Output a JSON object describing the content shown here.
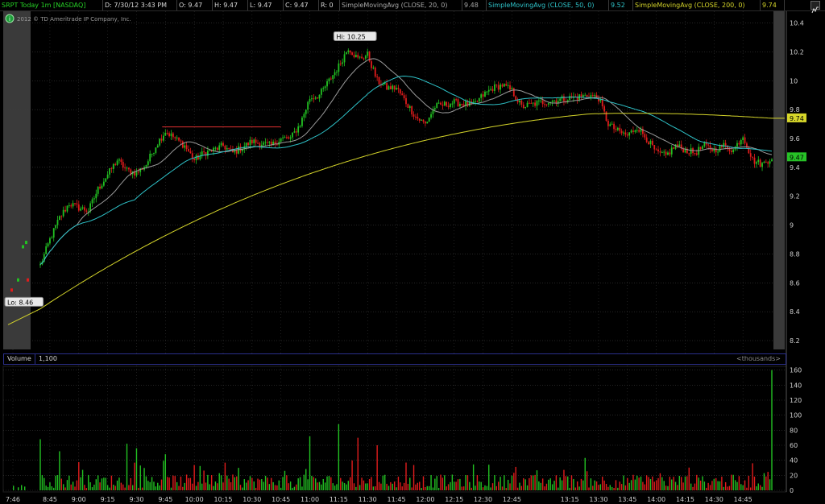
{
  "header": {
    "symbol": "SRPT Today 1m [NASDAQ]",
    "date": "D: 7/30/12 3:43 PM",
    "open": "O: 9.47",
    "high": "H: 9.47",
    "low": "L: 9.47",
    "close": "C: 9.47",
    "range": "R: 0",
    "sma20_label": "SimpleMovingAvg (CLOSE, 20, 0)",
    "sma20_value": "9.48",
    "sma50_label": "SimpleMovingAvg (CLOSE, 50, 0)",
    "sma50_value": "9.52",
    "sma200_label": "SimpleMovingAvg (CLOSE, 200, 0)",
    "sma200_value": "9.74",
    "settings_icon": "chart-settings-icon"
  },
  "copyright": "2012 © TD Ameritrade IP Company, Inc.",
  "info_icon": "info-icon",
  "colors": {
    "up": "#22c122",
    "down": "#e01c1c",
    "sma20": "#9a9a9a",
    "sma50": "#2ec2c8",
    "sma200": "#d6d62a",
    "grid": "#3c3c3c",
    "session_shade": "#3a3a3a",
    "hi_line": "#e03030"
  },
  "volume_header": {
    "label": "Volume",
    "value": "1,100",
    "units": "<thousands>"
  },
  "chart_data": [
    {
      "type": "candlestick",
      "title": "SRPT Today 1m [NASDAQ]",
      "ylim": [
        8.15,
        10.47
      ],
      "y_ticks": [
        8.2,
        8.4,
        8.6,
        8.8,
        9,
        9.2,
        9.4,
        9.6,
        9.8,
        10,
        10.2,
        10.4
      ],
      "y_tick_labels": [
        "8.2",
        "8.4",
        "8.6",
        "8.8",
        "9",
        "9.2",
        "9.4",
        "9.6",
        "9.8",
        "10",
        "10.2",
        "10.4"
      ],
      "x_tick_labels": [
        "7:46",
        "8:45",
        "9:00",
        "9:15",
        "9:30",
        "9:45",
        "10:00",
        "10:15",
        "10:30",
        "10:45",
        "11:00",
        "11:15",
        "11:30",
        "11:45",
        "12:00",
        "12:15",
        "12:30",
        "12:45",
        "13:15",
        "13:30",
        "13:45",
        "14:00",
        "14:15",
        "14:30",
        "14:45"
      ],
      "annotations": {
        "high": "Hi: 10.25",
        "low": "Lo: 8.46",
        "high_value": 10.25,
        "low_value": 8.46
      },
      "price_markers": [
        {
          "label": "9.74",
          "value": 9.74,
          "series": "SMA 200"
        },
        {
          "label": "9.47",
          "value": 9.47,
          "series": "Last"
        }
      ],
      "series": [
        {
          "name": "SimpleMovingAvg (CLOSE, 20, 0)",
          "last": 9.48
        },
        {
          "name": "SimpleMovingAvg (CLOSE, 50, 0)",
          "last": 9.52
        },
        {
          "name": "SimpleMovingAvg (CLOSE, 200, 0)",
          "last": 9.74
        }
      ],
      "close_path": [
        [
          "7:46",
          8.55
        ],
        [
          "8:30",
          8.65
        ],
        [
          "8:40",
          8.72
        ],
        [
          "8:45",
          8.9
        ],
        [
          "8:50",
          9.05
        ],
        [
          "8:55",
          9.15
        ],
        [
          "9:00",
          9.12
        ],
        [
          "9:05",
          9.1
        ],
        [
          "9:10",
          9.25
        ],
        [
          "9:15",
          9.35
        ],
        [
          "9:20",
          9.45
        ],
        [
          "9:25",
          9.38
        ],
        [
          "9:30",
          9.36
        ],
        [
          "9:35",
          9.42
        ],
        [
          "9:40",
          9.55
        ],
        [
          "9:45",
          9.65
        ],
        [
          "9:50",
          9.6
        ],
        [
          "9:55",
          9.55
        ],
        [
          "10:00",
          9.45
        ],
        [
          "10:05",
          9.5
        ],
        [
          "10:10",
          9.52
        ],
        [
          "10:15",
          9.55
        ],
        [
          "10:20",
          9.5
        ],
        [
          "10:30",
          9.58
        ],
        [
          "10:40",
          9.55
        ],
        [
          "10:45",
          9.6
        ],
        [
          "10:50",
          9.6
        ],
        [
          "10:55",
          9.7
        ],
        [
          "11:00",
          9.88
        ],
        [
          "11:05",
          9.9
        ],
        [
          "11:10",
          10.0
        ],
        [
          "11:15",
          10.1
        ],
        [
          "11:20",
          10.23
        ],
        [
          "11:25",
          10.15
        ],
        [
          "11:30",
          10.18
        ],
        [
          "11:35",
          10.0
        ],
        [
          "11:40",
          9.95
        ],
        [
          "11:45",
          9.95
        ],
        [
          "11:50",
          9.85
        ],
        [
          "11:55",
          9.75
        ],
        [
          "12:00",
          9.7
        ],
        [
          "12:05",
          9.82
        ],
        [
          "12:15",
          9.85
        ],
        [
          "12:25",
          9.83
        ],
        [
          "12:30",
          9.9
        ],
        [
          "12:35",
          9.95
        ],
        [
          "12:40",
          9.97
        ],
        [
          "12:45",
          9.93
        ],
        [
          "12:50",
          9.82
        ],
        [
          "13:00",
          9.85
        ],
        [
          "13:15",
          9.88
        ],
        [
          "13:25",
          9.9
        ],
        [
          "13:30",
          9.88
        ],
        [
          "13:35",
          9.7
        ],
        [
          "13:40",
          9.65
        ],
        [
          "13:45",
          9.62
        ],
        [
          "13:50",
          9.68
        ],
        [
          "13:55",
          9.6
        ],
        [
          "14:00",
          9.5
        ],
        [
          "14:05",
          9.48
        ],
        [
          "14:10",
          9.55
        ],
        [
          "14:15",
          9.52
        ],
        [
          "14:20",
          9.5
        ],
        [
          "14:25",
          9.55
        ],
        [
          "14:30",
          9.52
        ],
        [
          "14:35",
          9.55
        ],
        [
          "14:40",
          9.52
        ],
        [
          "14:45",
          9.62
        ],
        [
          "14:50",
          9.45
        ],
        [
          "14:55",
          9.42
        ],
        [
          "15:00",
          9.47
        ]
      ]
    },
    {
      "type": "bar",
      "title": "Volume",
      "units": "<thousands>",
      "ylim": [
        0,
        165
      ],
      "y_ticks": [
        0,
        20,
        40,
        60,
        80,
        100,
        120,
        140,
        160
      ],
      "y_tick_labels": [
        "0",
        "20",
        "40",
        "60",
        "80",
        "100",
        "120",
        "140",
        "160"
      ],
      "last_value": 1.1,
      "spikes": [
        {
          "x": "8:40",
          "value": 68
        },
        {
          "x": "8:50",
          "value": 52
        },
        {
          "x": "9:25",
          "value": 62
        },
        {
          "x": "9:30",
          "value": 56
        },
        {
          "x": "9:45",
          "value": 48
        },
        {
          "x": "11:00",
          "value": 72
        },
        {
          "x": "11:15",
          "value": 88
        },
        {
          "x": "11:25",
          "value": 70
        },
        {
          "x": "11:35",
          "value": 60
        },
        {
          "x": "14:50",
          "value": 36
        },
        {
          "x": "15:00",
          "value": 160
        }
      ]
    }
  ]
}
